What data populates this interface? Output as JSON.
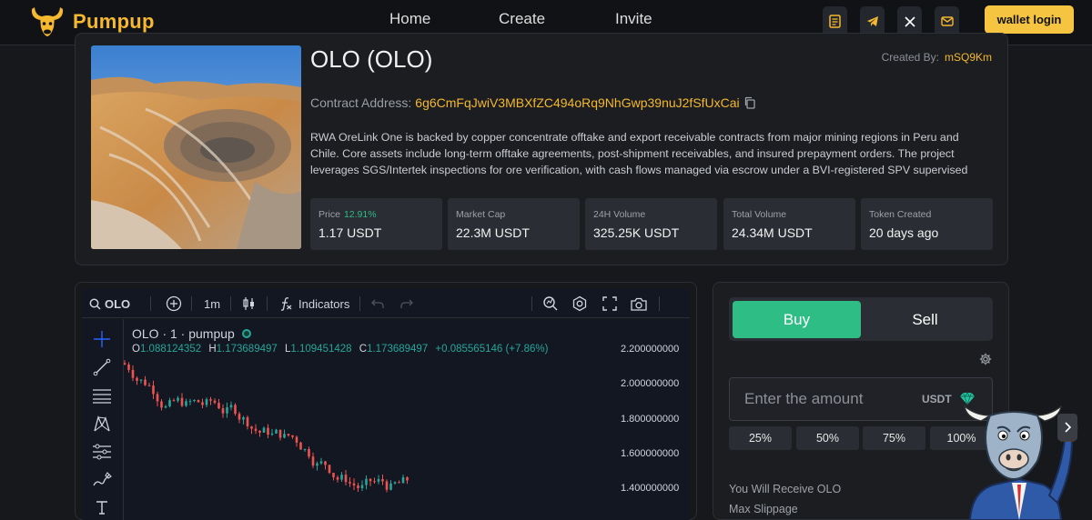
{
  "header": {
    "brand": "Pumpup",
    "nav": [
      "Home",
      "Create",
      "Invite"
    ],
    "icons": [
      "docs-icon",
      "telegram-icon",
      "x-icon",
      "mail-icon"
    ],
    "wallet_label": "wallet login"
  },
  "token": {
    "title": "OLO (OLO)",
    "created_by_label": "Created By:",
    "created_by": "mSQ9Km",
    "contract_label": "Contract Address:",
    "contract_address": "6g6CmFqJwiV3MBXfZC494oRq9NhGwp39nuJ2fSfUxCai",
    "description": "RWA OreLink One is backed by copper concentrate offtake and export receivable contracts from major mining regions in Peru and Chile. Core assets include long-term offtake agreements, post-shipment receivables, and insured prepayment orders. The project leverages SGS/Intertek inspections for ore verification, with cash flows managed via escrow under a BVI-registered SPV supervised by",
    "stats": [
      {
        "label": "Price",
        "change": "12.91%",
        "value": "1.17 USDT"
      },
      {
        "label": "Market Cap",
        "value": "22.3M USDT"
      },
      {
        "label": "24H Volume",
        "value": "325.25K USDT"
      },
      {
        "label": "Total Volume",
        "value": "24.34M USDT"
      },
      {
        "label": "Token Created",
        "value": "20 days ago"
      }
    ]
  },
  "chart": {
    "symbol": "OLO",
    "interval": "1m",
    "indicators_label": "Indicators",
    "legend_title": "OLO · 1 · pumpup",
    "ohlc": {
      "o_label": "O",
      "o": "1.088124352",
      "h_label": "H",
      "h": "1.173689497",
      "l_label": "L",
      "l": "1.109451428",
      "c_label": "C",
      "c": "1.173689497",
      "change": "+0.085565146 (+7.86%)"
    },
    "y_ticks": [
      "2.200000000",
      "2.000000000",
      "1.800000000",
      "1.600000000",
      "1.400000000"
    ],
    "up_color": "#26a69a",
    "down_color": "#ef5350"
  },
  "trade": {
    "buy_label": "Buy",
    "sell_label": "Sell",
    "amount_placeholder": "Enter the amount",
    "unit": "USDT",
    "percent_buttons": [
      "25%",
      "50%",
      "75%",
      "100%"
    ],
    "receive_label": "You Will Receive OLO",
    "slippage_label": "Max Slippage"
  },
  "colors": {
    "accent": "#f5b82e",
    "buy": "#2ebd85",
    "wallet": "#f5c542"
  }
}
